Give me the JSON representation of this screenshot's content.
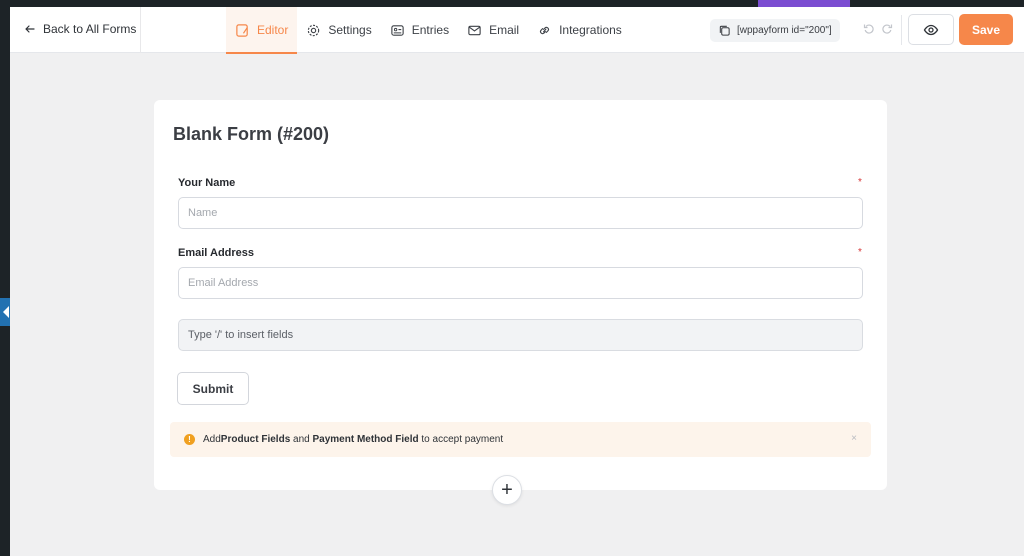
{
  "topbar": {
    "back_label": "Back to All Forms",
    "tabs": [
      {
        "label": "Editor",
        "icon": "editor-icon",
        "active": true
      },
      {
        "label": "Settings",
        "icon": "gear-icon"
      },
      {
        "label": "Entries",
        "icon": "entries-icon"
      },
      {
        "label": "Email",
        "icon": "mail-icon"
      },
      {
        "label": "Integrations",
        "icon": "link-icon"
      }
    ],
    "shortcode": "[wppayform id=\"200\"]",
    "save_label": "Save"
  },
  "form": {
    "title": "Blank Form (#200)",
    "fields": [
      {
        "label": "Your Name",
        "placeholder": "Name",
        "required": true
      },
      {
        "label": "Email Address",
        "placeholder": "Email Address",
        "required": true
      }
    ],
    "required_mark": "*",
    "insert_placeholder": "Type '/' to insert fields",
    "submit_label": "Submit"
  },
  "notice": {
    "prefix": "Add ",
    "product": "Product Fields",
    "middle": " and ",
    "payment": "Payment Method Field",
    "suffix": " to accept payment",
    "close": "×"
  },
  "add_block": "+",
  "colors": {
    "accent": "#f6874a",
    "wp_admin": "#1d2327",
    "notice_bg": "#fdf4eb",
    "warning": "#f0a020"
  }
}
